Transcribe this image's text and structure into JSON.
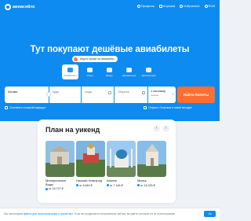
{
  "header": {
    "logo_text": "авиасейлс",
    "nav": [
      {
        "label": "Профиль",
        "icon": "profile-icon"
      },
      {
        "label": "Корзина",
        "icon": "cart-icon"
      },
      {
        "label": "Избранное",
        "icon": "heart-icon"
      },
      {
        "label": "RUB",
        "icon": "currency-icon"
      }
    ]
  },
  "hero": {
    "title": "Тут покупают дешёвые авиабилеты",
    "badge": "Ищите жильё на Авиасейлс",
    "tabs": [
      {
        "label": "Авиабилеты",
        "icon": "plane-icon",
        "active": true
      },
      {
        "label": "Отели",
        "icon": "hotel-icon",
        "active": false
      },
      {
        "label": "Вокруг",
        "icon": "compass-icon",
        "active": false
      },
      {
        "label": "Направления",
        "icon": "map-icon",
        "active": false
      },
      {
        "label": "Для блогеров",
        "icon": "star-icon",
        "active": false
      }
    ]
  },
  "search": {
    "from_value": "Москва",
    "to_placeholder": "Куда",
    "depart_placeholder": "Когда",
    "return_placeholder": "Обратно",
    "passengers_main": "1 пассажир",
    "passengers_sub": "эконом",
    "find_label": "Найти билеты",
    "route_option": "Составить сложный маршрут",
    "hotel_option": "Открыть Островок в новой вкладке"
  },
  "weekend": {
    "title": "План на уикенд",
    "prev_arrow": "‹",
    "next_arrow": "›",
    "cards": [
      {
        "city": "Минеральные Воды",
        "price": "от 16 737 ₽"
      },
      {
        "city": "Нижний Новгород",
        "price": "от 6 649 ₽"
      },
      {
        "city": "Казань",
        "price": "от 7 146 ₽"
      },
      {
        "city": "Минск",
        "price": "от 16 225 ₽"
      }
    ]
  },
  "footer": {
    "text": "Мы используем",
    "link": "файлы для персонализации и аналитики",
    "text2": "Если вы продолжите пользоваться сайтом, вы даёте согласие на их использование",
    "button": "Ок"
  },
  "colors": {
    "brand": "#0e8bf0",
    "action": "#ff6f32"
  }
}
